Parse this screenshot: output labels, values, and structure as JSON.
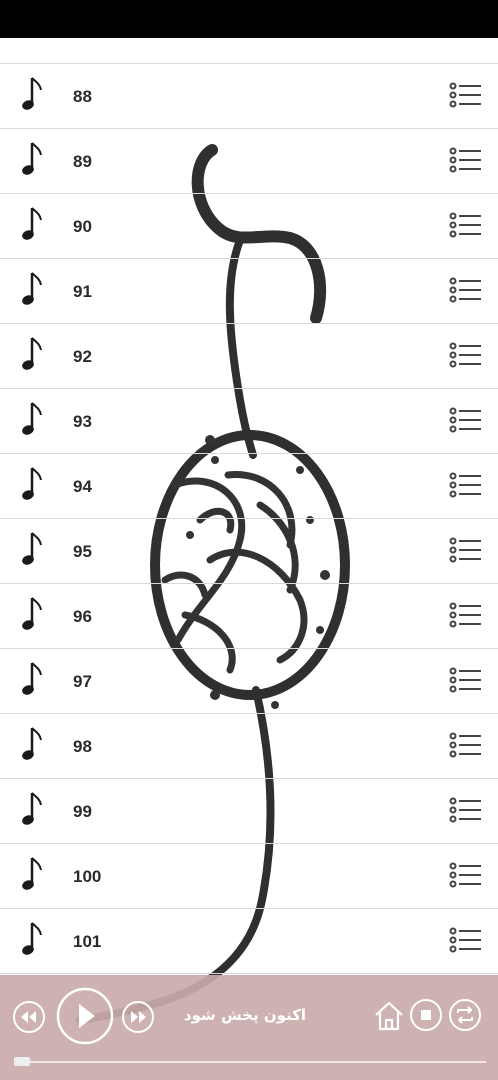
{
  "tracks": [
    {
      "number": "88"
    },
    {
      "number": "89"
    },
    {
      "number": "90"
    },
    {
      "number": "91"
    },
    {
      "number": "92"
    },
    {
      "number": "93"
    },
    {
      "number": "94"
    },
    {
      "number": "95"
    },
    {
      "number": "96"
    },
    {
      "number": "97"
    },
    {
      "number": "98"
    },
    {
      "number": "99"
    },
    {
      "number": "100"
    },
    {
      "number": "101"
    }
  ],
  "track_icons": {
    "leading": "music-note-icon",
    "trailing": "list-menu-icon"
  },
  "player": {
    "status_text": "اکنون پخش شود",
    "progress": 0.0,
    "controls": [
      "rewind-icon",
      "play-icon",
      "fast-forward-icon",
      "home-icon",
      "stop-icon",
      "repeat-icon"
    ]
  },
  "colors": {
    "player_background": "#c9abaa",
    "text": "#2b2b2b",
    "divider": "#d9d9d9",
    "icon": "#1a1a1a",
    "menu_icon": "#444444",
    "control": "#ffffff"
  }
}
